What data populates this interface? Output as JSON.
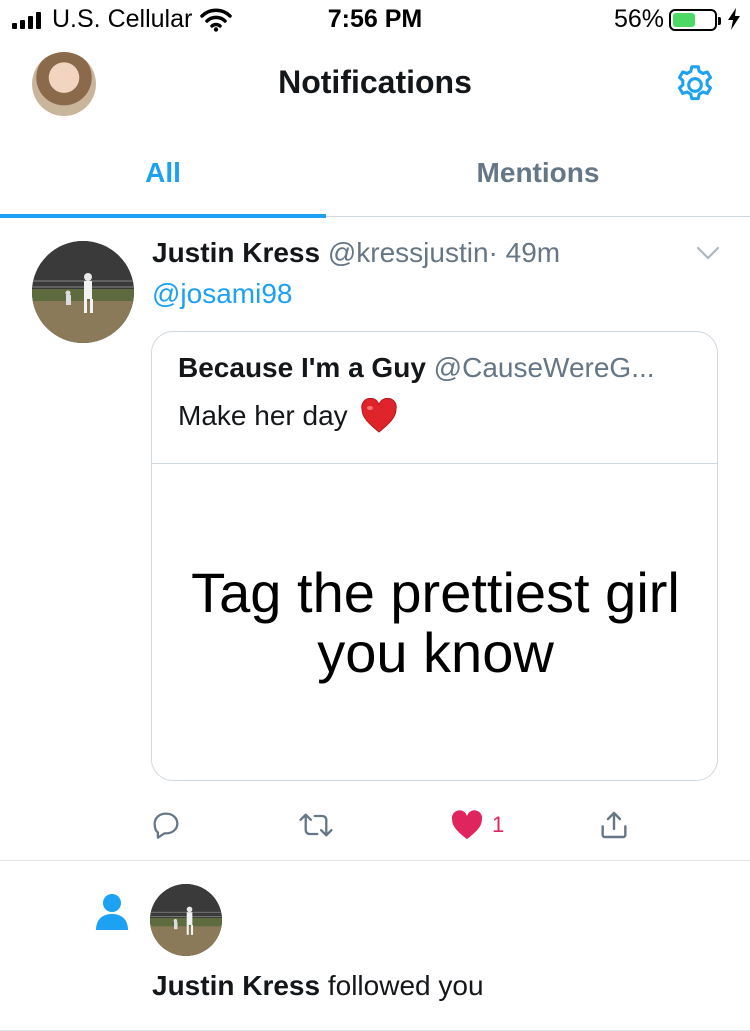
{
  "status_bar": {
    "carrier": "U.S. Cellular",
    "time": "7:56 PM",
    "battery_percent": "56%",
    "battery_level": 0.56
  },
  "header": {
    "title": "Notifications",
    "avatar_icon": "profile-avatar",
    "settings_icon": "gear-icon"
  },
  "tabs": [
    {
      "label": "All",
      "active": true
    },
    {
      "label": "Mentions",
      "active": false
    }
  ],
  "notifications": {
    "tweet": {
      "author_name": "Justin Kress",
      "author_handle": "@kressjustin",
      "separator": "·",
      "time": "49m",
      "text": "@josami98",
      "quote": {
        "author_name": "Because I'm a Guy",
        "author_handle": "@CauseWereG...",
        "text": "Make her day",
        "emoji": "❤️",
        "image_text_line1": "Tag the prettiest girl",
        "image_text_line2": "you know"
      },
      "actions": {
        "reply_icon": "reply-icon",
        "retweet_icon": "retweet-icon",
        "like_icon": "heart-icon",
        "like_count": "1",
        "share_icon": "share-icon"
      }
    },
    "follow": {
      "icon": "person-icon",
      "name": "Justin Kress",
      "action_text": "followed you"
    }
  },
  "colors": {
    "accent": "#1da1f2",
    "secondary_text": "#657786",
    "like": "#e0245e",
    "battery": "#4cd964"
  }
}
